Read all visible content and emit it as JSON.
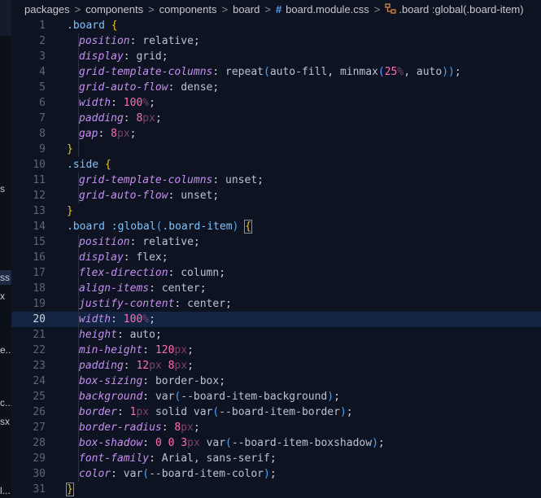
{
  "sidebar_fragments": [
    "s",
    "ss",
    "x",
    "e...",
    "c...",
    "sx",
    "l..."
  ],
  "breadcrumb": {
    "items": [
      "packages",
      "components",
      "components",
      "board",
      "board.module.css",
      ".board :global(.board-item)"
    ],
    "file_icon": "hash-icon",
    "symbol_icon": "symbol-class-icon"
  },
  "editor": {
    "current_line": 20,
    "lines": [
      {
        "n": "1",
        "tokens": [
          [
            "sel",
            ".board"
          ],
          [
            "punct",
            " "
          ],
          [
            "brace",
            "{"
          ]
        ]
      },
      {
        "n": "2",
        "tokens": [
          [
            "ind",
            ""
          ],
          [
            "prop",
            "position"
          ],
          [
            "punct",
            ": "
          ],
          [
            "val",
            "relative"
          ],
          [
            "punct",
            ";"
          ]
        ]
      },
      {
        "n": "3",
        "tokens": [
          [
            "ind",
            ""
          ],
          [
            "prop",
            "display"
          ],
          [
            "punct",
            ": "
          ],
          [
            "val",
            "grid"
          ],
          [
            "punct",
            ";"
          ]
        ]
      },
      {
        "n": "4",
        "tokens": [
          [
            "ind",
            ""
          ],
          [
            "prop",
            "grid-template-columns"
          ],
          [
            "punct",
            ": "
          ],
          [
            "fn",
            "repeat"
          ],
          [
            "paren",
            "("
          ],
          [
            "val",
            "auto-fill"
          ],
          [
            "punct",
            ", "
          ],
          [
            "fn",
            "minmax"
          ],
          [
            "paren",
            "("
          ],
          [
            "num",
            "25"
          ],
          [
            "unit",
            "%"
          ],
          [
            "punct",
            ", "
          ],
          [
            "val",
            "auto"
          ],
          [
            "paren",
            ")"
          ],
          [
            "paren",
            ")"
          ],
          [
            "punct",
            ";"
          ]
        ]
      },
      {
        "n": "5",
        "tokens": [
          [
            "ind",
            ""
          ],
          [
            "prop",
            "grid-auto-flow"
          ],
          [
            "punct",
            ": "
          ],
          [
            "val",
            "dense"
          ],
          [
            "punct",
            ";"
          ]
        ]
      },
      {
        "n": "6",
        "tokens": [
          [
            "ind",
            ""
          ],
          [
            "prop",
            "width"
          ],
          [
            "punct",
            ": "
          ],
          [
            "num",
            "100"
          ],
          [
            "unit",
            "%"
          ],
          [
            "punct",
            ";"
          ]
        ]
      },
      {
        "n": "7",
        "tokens": [
          [
            "ind",
            ""
          ],
          [
            "prop",
            "padding"
          ],
          [
            "punct",
            ": "
          ],
          [
            "num",
            "8"
          ],
          [
            "unit",
            "px"
          ],
          [
            "punct",
            ";"
          ]
        ]
      },
      {
        "n": "8",
        "tokens": [
          [
            "ind",
            ""
          ],
          [
            "prop",
            "gap"
          ],
          [
            "punct",
            ": "
          ],
          [
            "num",
            "8"
          ],
          [
            "unit",
            "px"
          ],
          [
            "punct",
            ";"
          ]
        ]
      },
      {
        "n": "9",
        "tokens": [
          [
            "brace",
            "}"
          ]
        ]
      },
      {
        "n": "10",
        "tokens": [
          [
            "sel",
            ".side"
          ],
          [
            "punct",
            " "
          ],
          [
            "brace",
            "{"
          ]
        ]
      },
      {
        "n": "11",
        "tokens": [
          [
            "ind",
            ""
          ],
          [
            "prop",
            "grid-template-columns"
          ],
          [
            "punct",
            ": "
          ],
          [
            "val",
            "unset"
          ],
          [
            "punct",
            ";"
          ]
        ]
      },
      {
        "n": "12",
        "tokens": [
          [
            "ind",
            ""
          ],
          [
            "prop",
            "grid-auto-flow"
          ],
          [
            "punct",
            ": "
          ],
          [
            "val",
            "unset"
          ],
          [
            "punct",
            ";"
          ]
        ]
      },
      {
        "n": "13",
        "tokens": [
          [
            "brace",
            "}"
          ]
        ]
      },
      {
        "n": "14",
        "tokens": [
          [
            "sel",
            ".board"
          ],
          [
            "punct",
            " "
          ],
          [
            "sel",
            ":global"
          ],
          [
            "paren",
            "("
          ],
          [
            "sel",
            ".board-item"
          ],
          [
            "paren",
            ")"
          ],
          [
            "punct",
            " "
          ],
          [
            "bracebox",
            "{"
          ]
        ]
      },
      {
        "n": "15",
        "tokens": [
          [
            "ind",
            ""
          ],
          [
            "prop",
            "position"
          ],
          [
            "punct",
            ": "
          ],
          [
            "val",
            "relative"
          ],
          [
            "punct",
            ";"
          ]
        ]
      },
      {
        "n": "16",
        "tokens": [
          [
            "ind",
            ""
          ],
          [
            "prop",
            "display"
          ],
          [
            "punct",
            ": "
          ],
          [
            "val",
            "flex"
          ],
          [
            "punct",
            ";"
          ]
        ]
      },
      {
        "n": "17",
        "tokens": [
          [
            "ind",
            ""
          ],
          [
            "prop",
            "flex-direction"
          ],
          [
            "punct",
            ": "
          ],
          [
            "val",
            "column"
          ],
          [
            "punct",
            ";"
          ]
        ]
      },
      {
        "n": "18",
        "tokens": [
          [
            "ind",
            ""
          ],
          [
            "prop",
            "align-items"
          ],
          [
            "punct",
            ": "
          ],
          [
            "val",
            "center"
          ],
          [
            "punct",
            ";"
          ]
        ]
      },
      {
        "n": "19",
        "tokens": [
          [
            "ind",
            ""
          ],
          [
            "prop",
            "justify-content"
          ],
          [
            "punct",
            ": "
          ],
          [
            "val",
            "center"
          ],
          [
            "punct",
            ";"
          ]
        ]
      },
      {
        "n": "20",
        "tokens": [
          [
            "ind",
            ""
          ],
          [
            "prop",
            "width"
          ],
          [
            "punct",
            ": "
          ],
          [
            "num",
            "100"
          ],
          [
            "unit",
            "%"
          ],
          [
            "punct",
            ";"
          ]
        ]
      },
      {
        "n": "21",
        "tokens": [
          [
            "ind",
            ""
          ],
          [
            "prop",
            "height"
          ],
          [
            "punct",
            ": "
          ],
          [
            "val",
            "auto"
          ],
          [
            "punct",
            ";"
          ]
        ]
      },
      {
        "n": "22",
        "tokens": [
          [
            "ind",
            ""
          ],
          [
            "prop",
            "min-height"
          ],
          [
            "punct",
            ": "
          ],
          [
            "num",
            "120"
          ],
          [
            "unit",
            "px"
          ],
          [
            "punct",
            ";"
          ]
        ]
      },
      {
        "n": "23",
        "tokens": [
          [
            "ind",
            ""
          ],
          [
            "prop",
            "padding"
          ],
          [
            "punct",
            ": "
          ],
          [
            "num",
            "12"
          ],
          [
            "unit",
            "px"
          ],
          [
            "punct",
            " "
          ],
          [
            "num",
            "8"
          ],
          [
            "unit",
            "px"
          ],
          [
            "punct",
            ";"
          ]
        ]
      },
      {
        "n": "24",
        "tokens": [
          [
            "ind",
            ""
          ],
          [
            "prop",
            "box-sizing"
          ],
          [
            "punct",
            ": "
          ],
          [
            "val",
            "border-box"
          ],
          [
            "punct",
            ";"
          ]
        ]
      },
      {
        "n": "25",
        "tokens": [
          [
            "ind",
            ""
          ],
          [
            "prop",
            "background"
          ],
          [
            "punct",
            ": "
          ],
          [
            "fn",
            "var"
          ],
          [
            "paren",
            "("
          ],
          [
            "val",
            "--board-item-background"
          ],
          [
            "paren",
            ")"
          ],
          [
            "punct",
            ";"
          ]
        ]
      },
      {
        "n": "26",
        "tokens": [
          [
            "ind",
            ""
          ],
          [
            "prop",
            "border"
          ],
          [
            "punct",
            ": "
          ],
          [
            "num",
            "1"
          ],
          [
            "unit",
            "px"
          ],
          [
            "punct",
            " "
          ],
          [
            "val",
            "solid "
          ],
          [
            "fn",
            "var"
          ],
          [
            "paren",
            "("
          ],
          [
            "val",
            "--board-item-border"
          ],
          [
            "paren",
            ")"
          ],
          [
            "punct",
            ";"
          ]
        ]
      },
      {
        "n": "27",
        "tokens": [
          [
            "ind",
            ""
          ],
          [
            "prop",
            "border-radius"
          ],
          [
            "punct",
            ": "
          ],
          [
            "num",
            "8"
          ],
          [
            "unit",
            "px"
          ],
          [
            "punct",
            ";"
          ]
        ]
      },
      {
        "n": "28",
        "tokens": [
          [
            "ind",
            ""
          ],
          [
            "prop",
            "box-shadow"
          ],
          [
            "punct",
            ": "
          ],
          [
            "num",
            "0"
          ],
          [
            "punct",
            " "
          ],
          [
            "num",
            "0"
          ],
          [
            "punct",
            " "
          ],
          [
            "num",
            "3"
          ],
          [
            "unit",
            "px"
          ],
          [
            "punct",
            " "
          ],
          [
            "fn",
            "var"
          ],
          [
            "paren",
            "("
          ],
          [
            "val",
            "--board-item-boxshadow"
          ],
          [
            "paren",
            ")"
          ],
          [
            "punct",
            ";"
          ]
        ]
      },
      {
        "n": "29",
        "tokens": [
          [
            "ind",
            ""
          ],
          [
            "prop",
            "font-family"
          ],
          [
            "punct",
            ": "
          ],
          [
            "val",
            "Arial, sans-serif"
          ],
          [
            "punct",
            ";"
          ]
        ]
      },
      {
        "n": "30",
        "tokens": [
          [
            "ind",
            ""
          ],
          [
            "prop",
            "color"
          ],
          [
            "punct",
            ": "
          ],
          [
            "fn",
            "var"
          ],
          [
            "paren",
            "("
          ],
          [
            "val",
            "--board-item-color"
          ],
          [
            "paren",
            ")"
          ],
          [
            "punct",
            ";"
          ]
        ]
      },
      {
        "n": "31",
        "tokens": [
          [
            "bracebox",
            "}"
          ]
        ]
      }
    ]
  }
}
